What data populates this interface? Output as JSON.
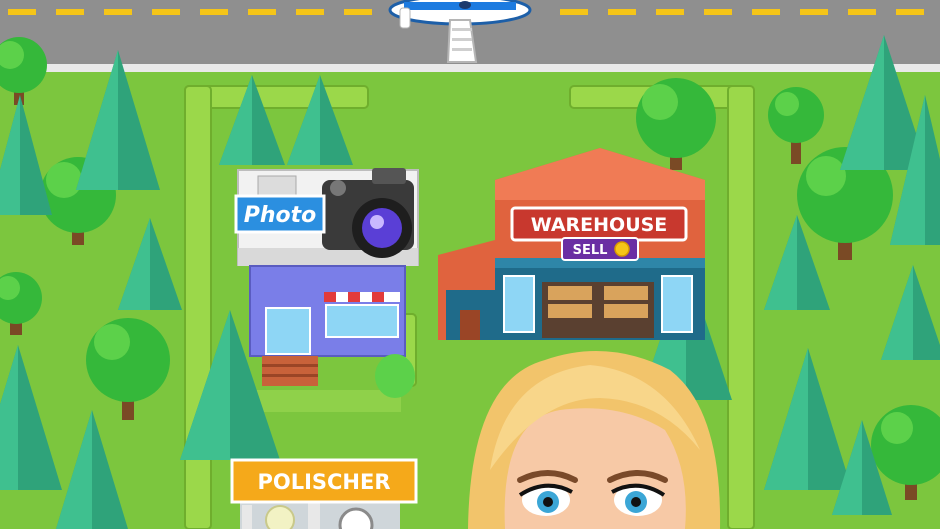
{
  "scene": {
    "type": "idle-tycoon-city-map",
    "colors": {
      "grass": "#7cc63e",
      "road": "#8f8f8f",
      "road_line": "#f5c518",
      "hedge": "#9bd84a",
      "tree_pine": "#2fa37a",
      "tree_round": "#35b83a",
      "warehouse_roof": "#e0633e",
      "warehouse_sign": "#c8382e",
      "sell_badge": "#6a2fa3",
      "polischer_sign": "#f5a91a",
      "photo_sign": "#2b8fe0"
    }
  },
  "buildings": {
    "photo": {
      "sign": "Photo"
    },
    "warehouse": {
      "sign": "WAREHOUSE",
      "sell_label": "SELL"
    },
    "polischer": {
      "sign": "POLISCHER"
    }
  },
  "vehicles": {
    "airplane": "airplane-icon"
  },
  "character": {
    "name": "blonde-manager-avatar"
  }
}
